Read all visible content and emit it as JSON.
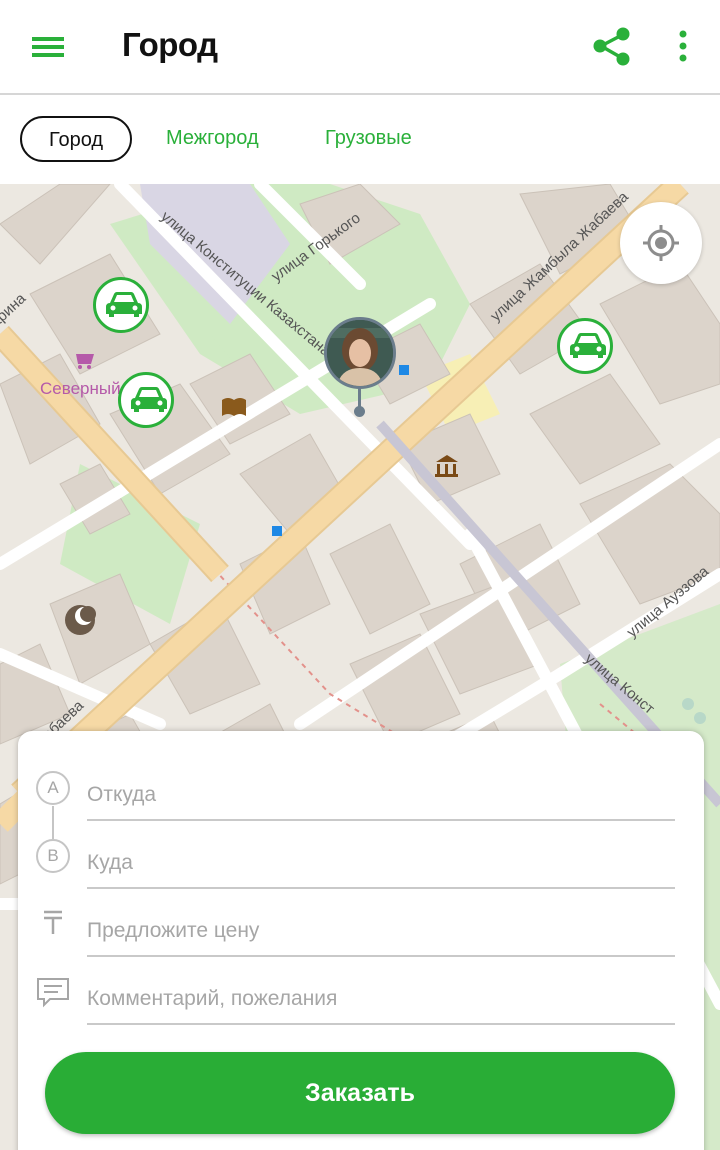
{
  "app_bar": {
    "title": "Город"
  },
  "tabs": [
    {
      "label": "Город",
      "active": true
    },
    {
      "label": "Межгород",
      "active": false
    },
    {
      "label": "Грузовые",
      "active": false
    }
  ],
  "map": {
    "streets": [
      "улица Конституции Казахстана",
      "улица Горького",
      "улица Жамбыла Жабаева",
      "арина",
      "Жабаева",
      "улица Ауэзова",
      "улица Конст"
    ],
    "poi_label": "Северный 2",
    "markers": [
      "car-marker",
      "car-marker",
      "car-marker",
      "user-pin"
    ]
  },
  "form": {
    "from_marker": "A",
    "to_marker": "B",
    "from_placeholder": "Откуда",
    "to_placeholder": "Куда",
    "price_placeholder": "Предложите цену",
    "comment_placeholder": "Комментарий, пожелания",
    "order_button": "Заказать"
  },
  "colors": {
    "accent": "#29ad36",
    "text": "#111111",
    "placeholder": "#a6a6a6"
  },
  "icons": [
    "menu-icon",
    "share-icon",
    "more-vertical-icon",
    "my-location-icon",
    "car-icon",
    "tenge-icon",
    "comment-icon"
  ]
}
